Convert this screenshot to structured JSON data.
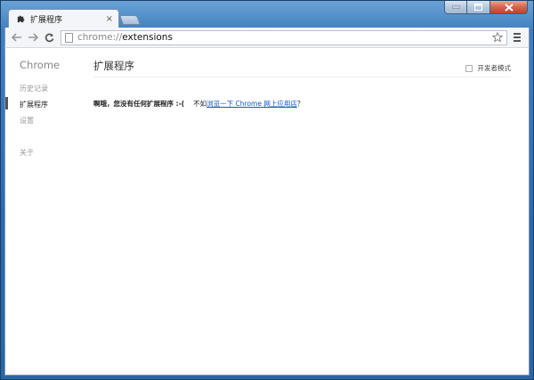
{
  "window": {
    "controls": [
      "minimize",
      "maximize",
      "close"
    ]
  },
  "tab": {
    "title": "扩展程序",
    "icon": "puzzle-piece-icon",
    "close_label": "×"
  },
  "toolbar": {
    "back_icon": "back-arrow-icon",
    "forward_icon": "forward-arrow-icon",
    "reload_icon": "reload-icon",
    "url_scheme": "chrome://",
    "url_host": "extensions",
    "star_icon": "star-icon",
    "menu_icon": "hamburger-menu-icon"
  },
  "sidebar": {
    "brand": "Chrome",
    "items": [
      {
        "label": "历史记录"
      },
      {
        "label": "扩展程序"
      },
      {
        "label": "设置"
      },
      {
        "label": "关于"
      }
    ],
    "selected_index": 1
  },
  "main": {
    "title": "扩展程序",
    "developer_mode_label": "开发者模式",
    "developer_mode_checked": false,
    "empty_message_bold": "啊哦，您没有任何扩展程序 :-(",
    "empty_message_prefix": "不如",
    "empty_message_link": "浏览一下 Chrome 网上应用店",
    "empty_message_suffix": "？"
  },
  "colors": {
    "link": "#1155cc",
    "frame": "#2c69ab"
  }
}
